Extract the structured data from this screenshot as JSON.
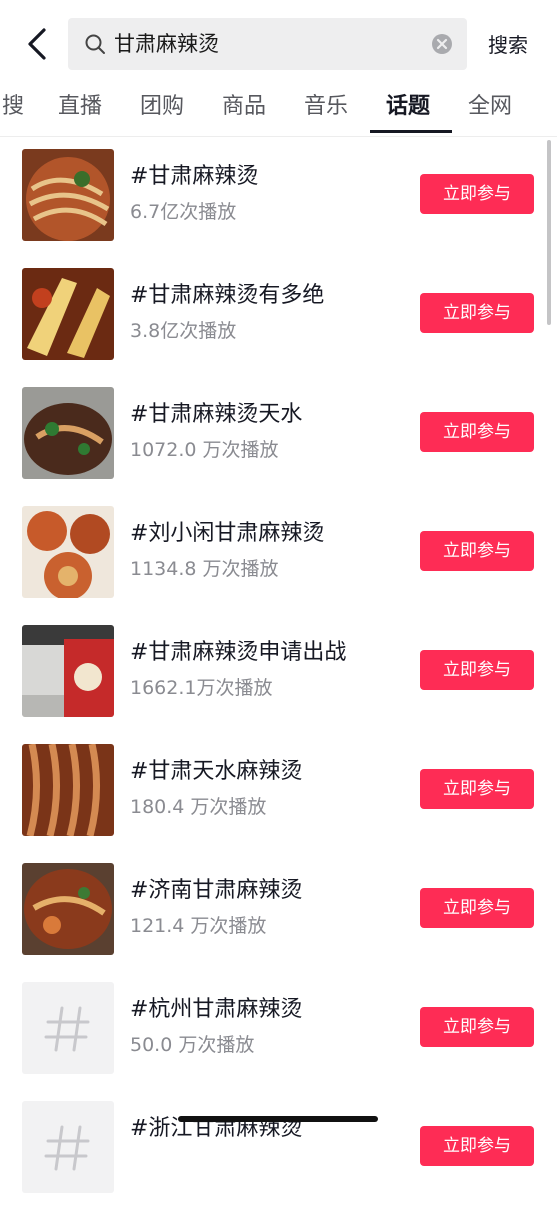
{
  "search": {
    "query": "甘肃麻辣烫",
    "submit_label": "搜索"
  },
  "tabs": [
    "搜",
    "直播",
    "团购",
    "商品",
    "音乐",
    "话题",
    "全网"
  ],
  "active_tab": "话题",
  "join_label": "立即参与",
  "topics": [
    {
      "title": "#甘肃麻辣烫",
      "plays": "6.7亿次播放"
    },
    {
      "title": "#甘肃麻辣烫有多绝",
      "plays": "3.8亿次播放"
    },
    {
      "title": "#甘肃麻辣烫天水",
      "plays": "1072.0 万次播放"
    },
    {
      "title": "#刘小闲甘肃麻辣烫",
      "plays": "1134.8 万次播放"
    },
    {
      "title": "#甘肃麻辣烫申请出战",
      "plays": "1662.1万次播放"
    },
    {
      "title": "#甘肃天水麻辣烫",
      "plays": "180.4 万次播放"
    },
    {
      "title": "#济南甘肃麻辣烫",
      "plays": "121.4 万次播放"
    },
    {
      "title": "#杭州甘肃麻辣烫",
      "plays": "50.0 万次播放"
    },
    {
      "title": "#浙江甘肃麻辣烫",
      "plays": ""
    }
  ],
  "colors": {
    "accent": "#fe2c55",
    "text": "#161823",
    "muted": "#8a8b91"
  }
}
